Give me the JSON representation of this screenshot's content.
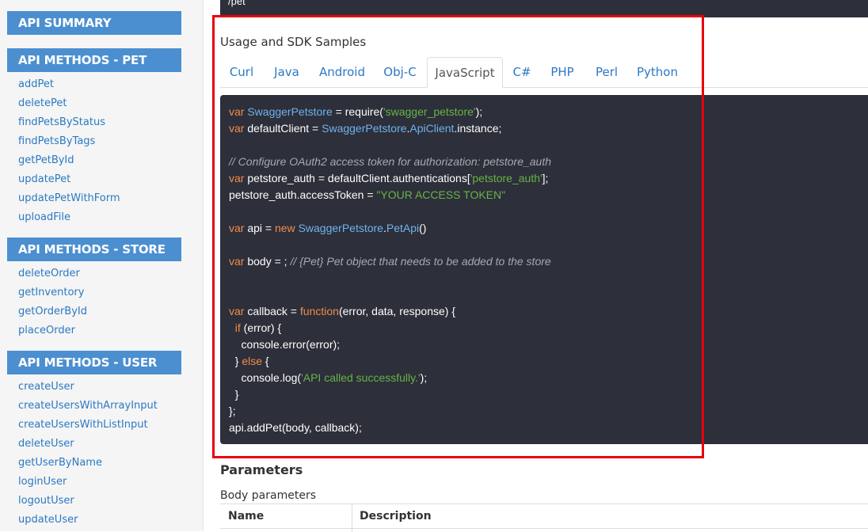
{
  "sidebar": {
    "summary_header": "API SUMMARY",
    "sections": [
      {
        "header": "API METHODS - PET",
        "links": [
          "addPet",
          "deletePet",
          "findPetsByStatus",
          "findPetsByTags",
          "getPetById",
          "updatePet",
          "updatePetWithForm",
          "uploadFile"
        ]
      },
      {
        "header": "API METHODS - STORE",
        "links": [
          "deleteOrder",
          "getInventory",
          "getOrderById",
          "placeOrder"
        ]
      },
      {
        "header": "API METHODS - USER",
        "links": [
          "createUser",
          "createUsersWithArrayInput",
          "createUsersWithListInput",
          "deleteUser",
          "getUserByName",
          "loginUser",
          "logoutUser",
          "updateUser"
        ]
      }
    ]
  },
  "main": {
    "endpoint_path": "/pet",
    "usage_title": "Usage and SDK Samples",
    "tabs": [
      "Curl",
      "Java",
      "Android",
      "Obj-C",
      "JavaScript",
      "C#",
      "PHP",
      "Perl",
      "Python"
    ],
    "active_tab": "JavaScript",
    "code": {
      "l1": [
        "var",
        " ",
        "SwaggerPetstore",
        " = require(",
        "'swagger_petstore'",
        ");"
      ],
      "l2": [
        "var",
        " defaultClient = ",
        "SwaggerPetstore",
        ".",
        "ApiClient",
        ".instance;"
      ],
      "l4": "// Configure OAuth2 access token for authorization: petstore_auth",
      "l5": [
        "var",
        " petstore_auth = defaultClient.authentications[",
        "'petstore_auth'",
        "];"
      ],
      "l6": [
        "petstore_auth.accessToken = ",
        "\"YOUR ACCESS TOKEN\""
      ],
      "l8": [
        "var",
        " api = ",
        "new",
        " ",
        "SwaggerPetstore",
        ".",
        "PetApi",
        "()"
      ],
      "l10": [
        "var",
        " body = ; ",
        "// {Pet} Pet object that needs to be added to the store"
      ],
      "l13": [
        "var",
        " callback = ",
        "function",
        "(error, data, response) {"
      ],
      "l14": [
        "  ",
        "if",
        " (error) {"
      ],
      "l15": "    console.error(error);",
      "l16": [
        "  } ",
        "else",
        " {"
      ],
      "l17": [
        "    console.log(",
        "'API called successfully.'",
        ");"
      ],
      "l18": "  }",
      "l19": "};",
      "l20": "api.addPet(body, callback);"
    },
    "parameters_title": "Parameters",
    "body_parameters": "Body parameters",
    "table_headers": [
      "Name",
      "Description"
    ]
  },
  "colors": {
    "sidebar_header": "#4b8fd0",
    "link": "#2b79c2",
    "code_bg": "#2d2f3a",
    "keyword": "#f08d49",
    "class": "#6fb3ee",
    "string": "#7ec699",
    "comment": "#a7a9b2",
    "highlight_box": "#e8000b"
  }
}
